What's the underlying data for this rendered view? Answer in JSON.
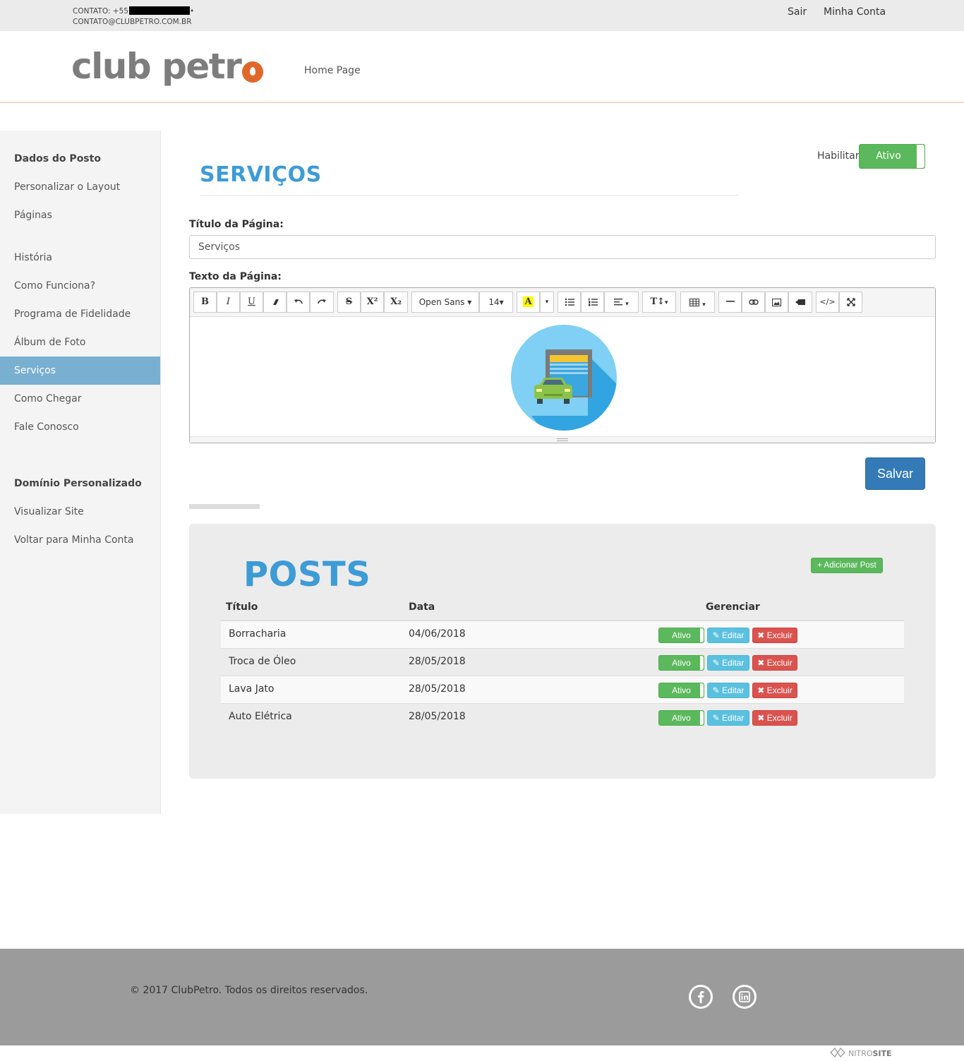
{
  "topbar": {
    "contact_phone": "CONTATO: +55",
    "contact_email": "CONTATO@CLUBPETRO.COM.BR",
    "sair": "Sair",
    "minha_conta": "Minha Conta"
  },
  "header": {
    "logo_text": "club petr",
    "nav_home": "Home Page"
  },
  "sidebar": {
    "items": [
      {
        "label": "Dados do Posto"
      },
      {
        "label": "Personalizar o Layout"
      },
      {
        "label": "Páginas"
      },
      {
        "label": "História"
      },
      {
        "label": "Como Funciona?"
      },
      {
        "label": "Programa de Fidelidade"
      },
      {
        "label": "Álbum de Foto"
      },
      {
        "label": "Serviços"
      },
      {
        "label": "Como Chegar"
      },
      {
        "label": "Fale Conosco"
      },
      {
        "label": "Domínio Personalizado"
      },
      {
        "label": "Visualizar Site"
      },
      {
        "label": "Voltar para Minha Conta"
      }
    ]
  },
  "page": {
    "title": "SERVIÇOS",
    "habilitar_label": "Habilitar",
    "habilitar_state": "Ativo",
    "titulo_label": "Título da Página:",
    "titulo_value": "Serviços",
    "texto_label": "Texto da Página:",
    "font_family": "Open Sans",
    "font_size": "14",
    "salvar": "Salvar"
  },
  "editor_toolbar": {
    "bold": "B",
    "italic": "I",
    "underline": "U",
    "strike": "S",
    "superscript": "X²",
    "subscript": "X₂",
    "line_height": "T↕"
  },
  "posts": {
    "title": "POSTS",
    "add_button": "+ Adicionar Post",
    "headers": [
      "Título",
      "Data",
      "Gerenciar"
    ],
    "rows": [
      {
        "titulo": "Borracharia",
        "data": "04/06/2018"
      },
      {
        "titulo": "Troca de Óleo",
        "data": "28/05/2018"
      },
      {
        "titulo": "Lava Jato",
        "data": "28/05/2018"
      },
      {
        "titulo": "Auto Elétrica",
        "data": "28/05/2018"
      }
    ],
    "ativo_label": "Ativo",
    "editar_label": "Editar",
    "excluir_label": "Excluir"
  },
  "footer": {
    "copyright": "© 2017 ClubPetro. Todos os direitos reservados.",
    "credit_a": "NITRO",
    "credit_b": "SITE"
  },
  "colors": {
    "accent_blue": "#3d9bd5",
    "sidebar_active": "#79afd0",
    "success": "#5cb85c",
    "info": "#5bc0de",
    "danger": "#d9534f",
    "primary": "#337ab7",
    "logo_orange": "#e0672a"
  }
}
